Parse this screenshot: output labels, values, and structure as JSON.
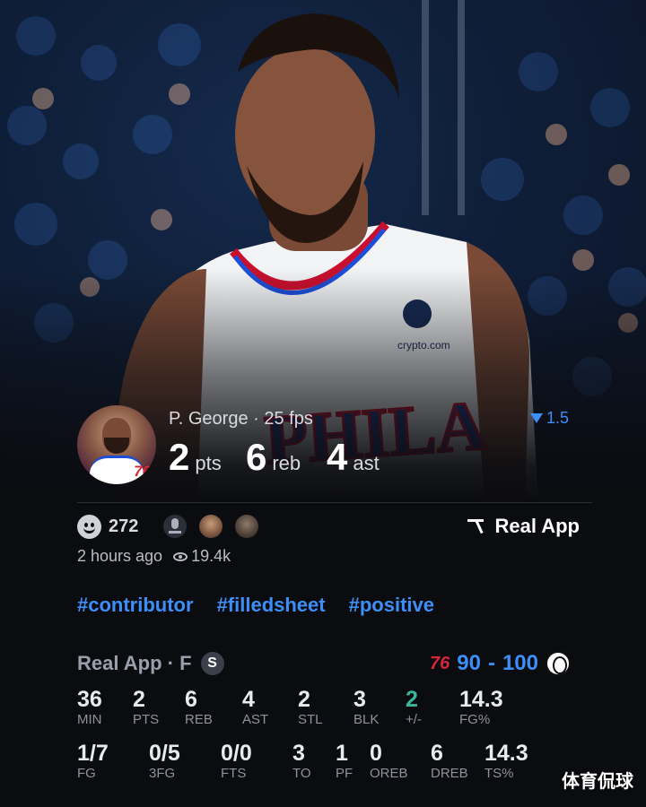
{
  "player": {
    "name": "P. George",
    "fps": "25 fps",
    "name_line": "P. George · 25 fps",
    "trend_value": "1.5",
    "pts": "2",
    "pts_label": "pts",
    "reb": "6",
    "reb_label": "reb",
    "ast": "4",
    "ast_label": "ast",
    "avatar_team_logo": "76"
  },
  "reactions": {
    "count": "272",
    "brand_link": "Real App",
    "time_ago": "2 hours ago",
    "views": "19.4k"
  },
  "tags": [
    "#contributor",
    "#filledsheet",
    "#positive"
  ],
  "box": {
    "title": "Real App · F",
    "badge": "S",
    "team_a_logo": "76",
    "score_a": "90",
    "score_sep": "-",
    "score_b": "100",
    "row1": [
      {
        "value": "36",
        "label": "MIN"
      },
      {
        "value": "2",
        "label": "PTS"
      },
      {
        "value": "6",
        "label": "REB"
      },
      {
        "value": "4",
        "label": "AST"
      },
      {
        "value": "2",
        "label": "STL"
      },
      {
        "value": "3",
        "label": "BLK"
      },
      {
        "value": "2",
        "label": "+/-"
      },
      {
        "value": "14.3",
        "label": "FG%"
      }
    ],
    "row2": [
      {
        "value": "1/7",
        "label": "FG"
      },
      {
        "value": "0/5",
        "label": "3FG"
      },
      {
        "value": "0/0",
        "label": "FTS"
      },
      {
        "value": "3",
        "label": "TO"
      },
      {
        "value": "1",
        "label": "PF"
      },
      {
        "value": "0",
        "label": "OREB"
      },
      {
        "value": "6",
        "label": "DREB"
      },
      {
        "value": "14.3",
        "label": "TS%"
      }
    ]
  },
  "watermark": "体育侃球",
  "colors": {
    "accent": "#3d8ef7",
    "positive": "#3bb59a",
    "team_red": "#d72638",
    "bg": "#0b0c10"
  }
}
